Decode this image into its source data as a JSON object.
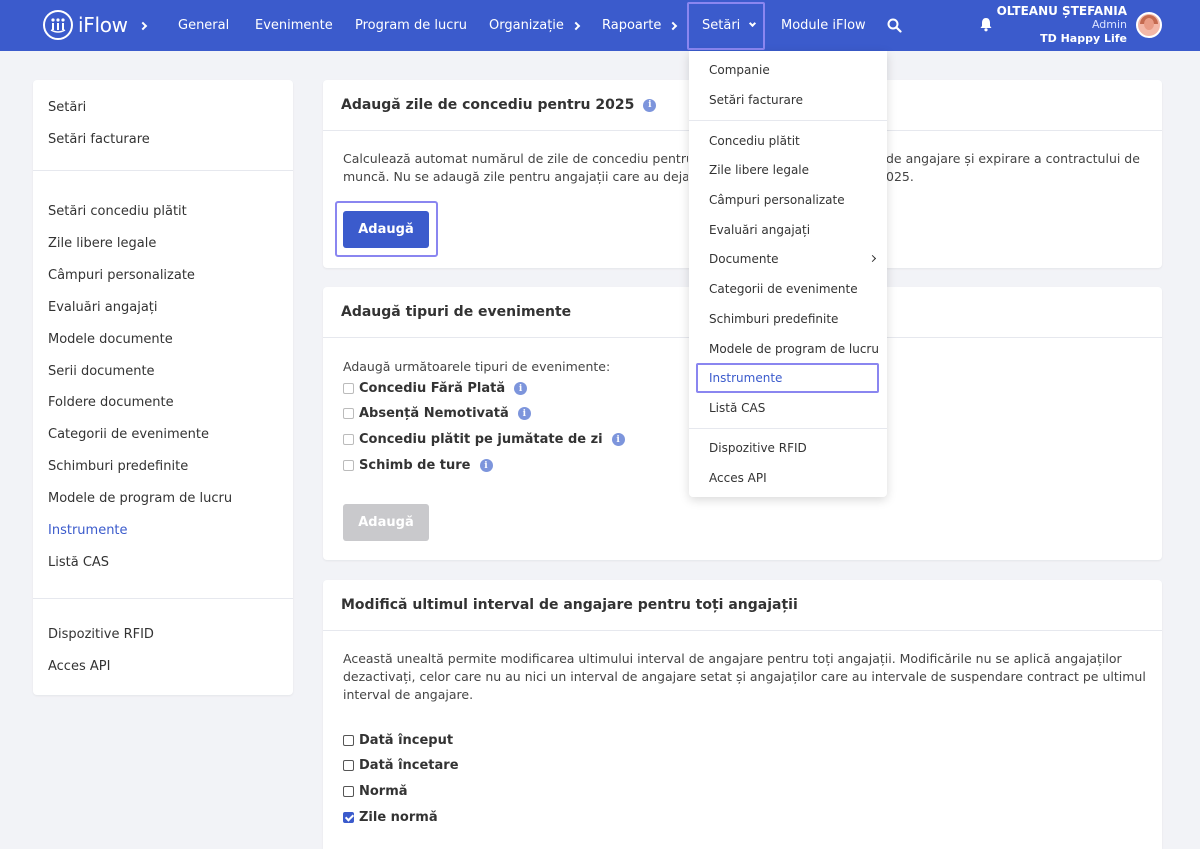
{
  "nav": {
    "brand": "iFlow",
    "items": [
      "General",
      "Evenimente",
      "Program de lucru",
      "Organizație",
      "Rapoarte",
      "Setări",
      "Module iFlow"
    ],
    "user_name": "OLTEANU ȘTEFANIA",
    "user_role": "Admin",
    "user_company": "TD Happy Life"
  },
  "sidebar": {
    "items": [
      "Setări",
      "Setări facturare",
      "Setări concediu plătit",
      "Zile libere legale",
      "Câmpuri personalizate",
      "Evaluări angajați",
      "Modele documente",
      "Serii documente",
      "Foldere documente",
      "Categorii de evenimente",
      "Schimburi predefinite",
      "Modele de program de lucru",
      "Instrumente",
      "Listă CAS",
      "Dispozitive RFID",
      "Acces API"
    ]
  },
  "card1": {
    "title": "Adaugă zile de concediu pentru 2025",
    "line1_left": "Calculează automat numărul de zile de concediu pentru 20",
    "line1_right": "de angajare și expirare a contractului de",
    "line2_left": "muncă. Nu se adaugă zile pentru angajații care au deja atr",
    "line2_right": "025.",
    "button": "Adaugă"
  },
  "card2": {
    "title": "Adaugă tipuri de evenimente",
    "intro": "Adaugă următoarele tipuri de evenimente:",
    "options": [
      "Concediu Fără Plată",
      "Absență Nemotivată",
      "Concediu plătit pe jumătate de zi",
      "Schimb de ture"
    ],
    "button": "Adaugă"
  },
  "card3": {
    "title": "Modifică ultimul interval de angajare pentru toți angajații",
    "line1": "Această unealtă permite modificarea ultimului interval de angajare pentru toți angajații. Modificările nu se aplică angajaților",
    "line2": "dezactivați, celor care nu au nici un interval de angajare setat și angajaților care au intervale de suspendare contract pe ultimul",
    "line3": "interval de angajare.",
    "options": [
      "Dată început",
      "Dată încetare",
      "Normă",
      "Zile normă"
    ]
  },
  "dropdown": {
    "items": [
      "Companie",
      "Setări facturare",
      "Concediu plătit",
      "Zile libere legale",
      "Câmpuri personalizate",
      "Evaluări angajați",
      "Documente",
      "Categorii de evenimente",
      "Schimburi predefinite",
      "Modele de program de lucru",
      "Instrumente",
      "Listă CAS",
      "Dispozitive RFID",
      "Acces API"
    ]
  },
  "colors": {
    "primary": "#3b5bcc",
    "highlight": "#8a86f0",
    "background": "#f2f3f7"
  }
}
